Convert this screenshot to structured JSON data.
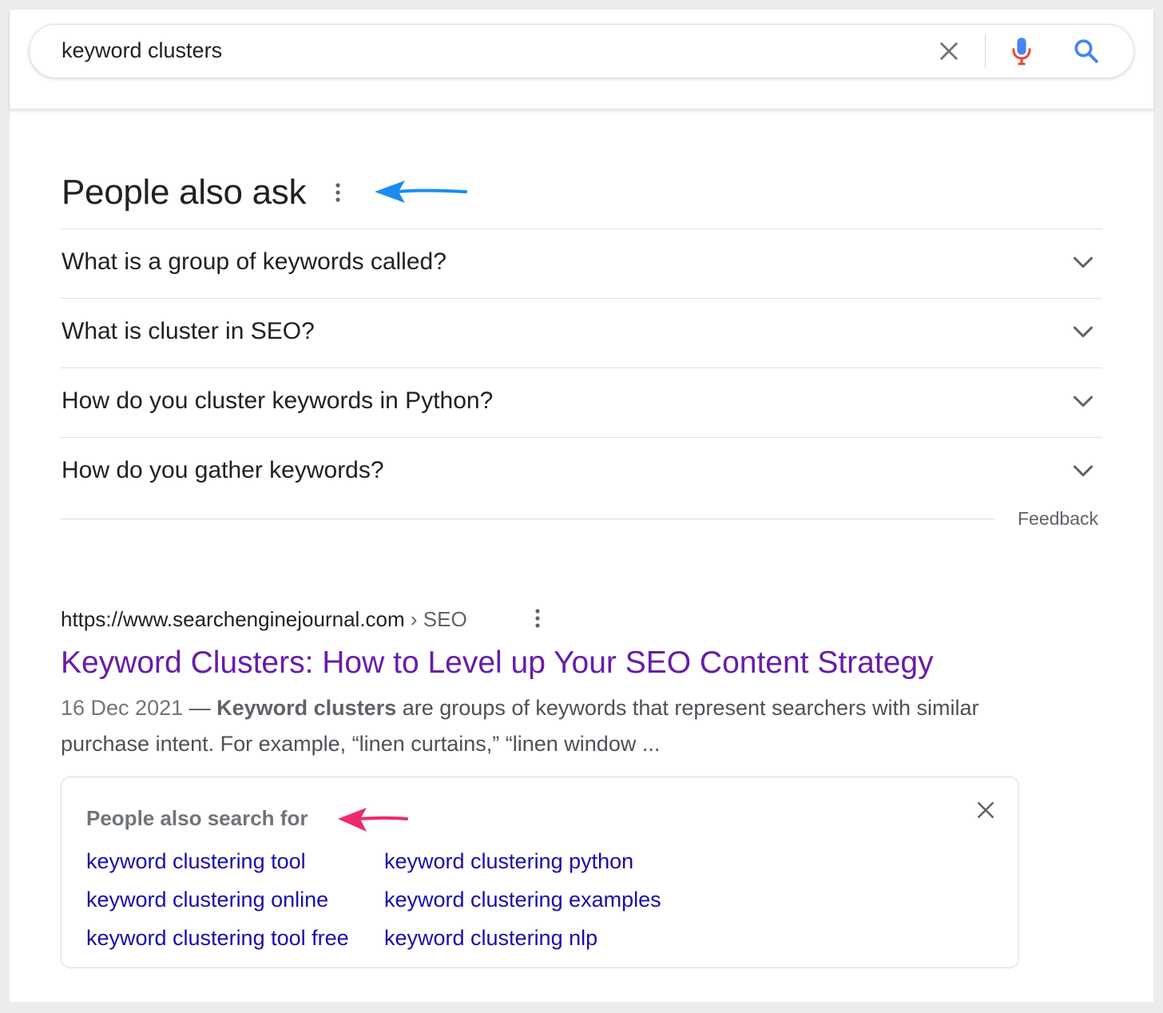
{
  "search": {
    "query": "keyword clusters"
  },
  "people_also_ask": {
    "title": "People also ask",
    "questions": [
      "What is a group of keywords called?",
      "What is cluster in SEO?",
      "How do you cluster keywords in Python?",
      "How do you gather keywords?"
    ],
    "feedback_label": "Feedback"
  },
  "result": {
    "url": "https://www.searchenginejournal.com",
    "breadcrumb": "› SEO",
    "title": "Keyword Clusters: How to Level up Your SEO Content Strategy",
    "date": "16 Dec 2021",
    "separator": " — ",
    "snippet_bold": "Keyword clusters",
    "snippet_rest": " are groups of keywords that represent searchers with similar purchase intent. For example, “linen curtains,” “linen window ..."
  },
  "people_also_search_for": {
    "title": "People also search for",
    "links": [
      "keyword clustering tool",
      "keyword clustering python",
      "keyword clustering online",
      "keyword clustering examples",
      "keyword clustering tool free",
      "keyword clustering nlp"
    ]
  },
  "colors": {
    "annotation_arrow_blue": "#1a8cef",
    "annotation_arrow_pink": "#ee2a6b",
    "visited_link": "#681da8",
    "link": "#1a0dab"
  },
  "icons": [
    "close-icon",
    "microphone-icon",
    "search-icon",
    "more-vert-icon",
    "chevron-down-icon",
    "arrow-left-icon"
  ]
}
